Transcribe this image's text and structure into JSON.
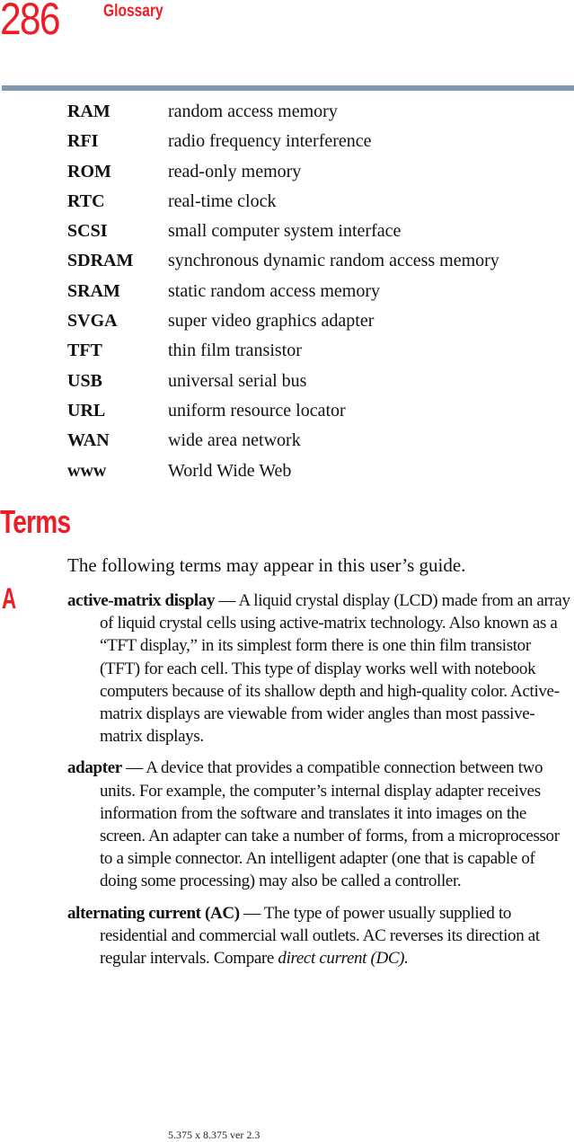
{
  "header": {
    "page_number": "286",
    "running_head": "Glossary",
    "rule_color": "#7f9ab0",
    "accent_color": "#ee1c25"
  },
  "abbreviations": [
    {
      "term": "RAM",
      "definition": "random access memory"
    },
    {
      "term": "RFI",
      "definition": "radio frequency interference"
    },
    {
      "term": "ROM",
      "definition": "read-only memory"
    },
    {
      "term": "RTC",
      "definition": "real-time clock"
    },
    {
      "term": "SCSI",
      "definition": "small computer system interface"
    },
    {
      "term": "SDRAM",
      "definition": "synchronous dynamic random access memory"
    },
    {
      "term": "SRAM",
      "definition": "static random access memory"
    },
    {
      "term": "SVGA",
      "definition": "super video graphics adapter"
    },
    {
      "term": "TFT",
      "definition": "thin film transistor"
    },
    {
      "term": "USB",
      "definition": "universal serial bus"
    },
    {
      "term": "URL",
      "definition": "uniform resource locator"
    },
    {
      "term": "WAN",
      "definition": "wide area network"
    },
    {
      "term": "www",
      "definition": "World Wide Web"
    }
  ],
  "terms_section": {
    "title": "Terms",
    "intro": "The following terms may appear in this user’s guide.",
    "letter": "A",
    "entries": [
      {
        "term": "active-matrix display",
        "definition": " — A liquid crystal display (LCD) made from an array of liquid crystal cells using active-matrix technology. Also known as a “TFT display,” in its simplest form there is one thin film transistor (TFT) for each cell. This type of display works well with notebook computers because of its shallow depth and high-quality color. Active-matrix displays are viewable from wider angles than most passive-matrix displays.",
        "see_also": ""
      },
      {
        "term": "adapter",
        "definition": " — A device that provides a compatible connection between two units. For example, the computer’s internal display adapter receives information from the software and translates it into images on the screen. An adapter can take a number of forms, from a microprocessor to a simple connector. An intelligent adapter (one that is capable of doing some processing) may also be called a controller.",
        "see_also": ""
      },
      {
        "term": "alternating current (AC)",
        "definition": " — The type of power usually supplied to residential and commercial wall outlets. AC reverses its direction at regular intervals. Compare ",
        "see_also": "direct current (DC)."
      }
    ]
  },
  "footer": {
    "text": "5.375 x 8.375 ver 2.3"
  }
}
